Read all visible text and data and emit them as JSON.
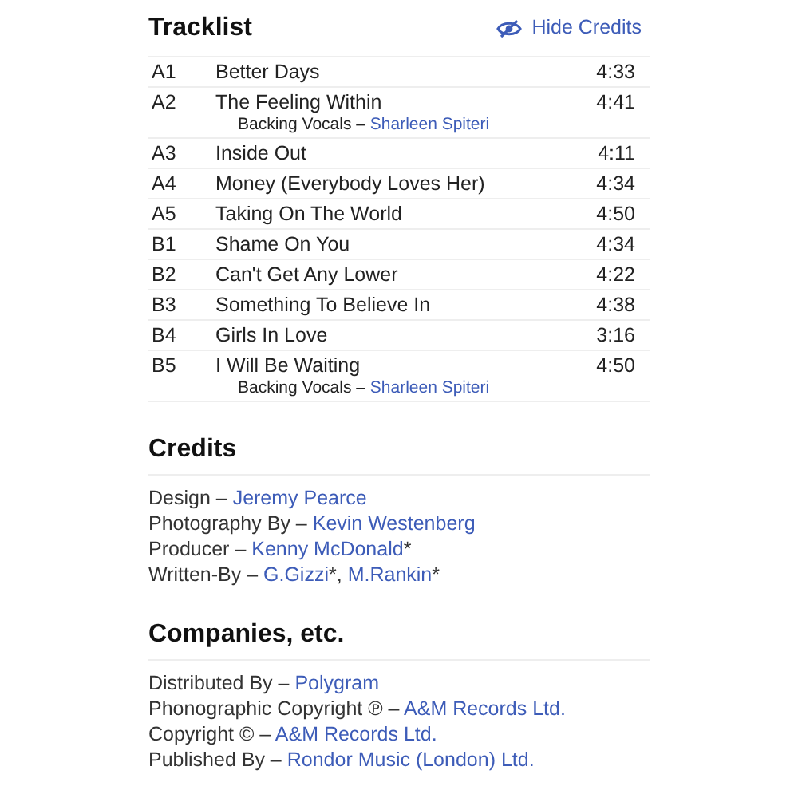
{
  "tracklist": {
    "title": "Tracklist",
    "toggle": "Hide Credits",
    "tracks": [
      {
        "position": "A1",
        "title": "Better Days",
        "duration": "4:33"
      },
      {
        "position": "A2",
        "title": "The Feeling Within",
        "duration": "4:41",
        "credit": {
          "role": "Backing Vocals –",
          "name": "Sharleen Spiteri"
        }
      },
      {
        "position": "A3",
        "title": "Inside Out",
        "duration": "4:11"
      },
      {
        "position": "A4",
        "title": "Money (Everybody Loves Her)",
        "duration": "4:34"
      },
      {
        "position": "A5",
        "title": "Taking On The World",
        "duration": "4:50"
      },
      {
        "position": "B1",
        "title": "Shame On You",
        "duration": "4:34"
      },
      {
        "position": "B2",
        "title": "Can't Get Any Lower",
        "duration": "4:22"
      },
      {
        "position": "B3",
        "title": "Something To Believe In",
        "duration": "4:38"
      },
      {
        "position": "B4",
        "title": "Girls In Love",
        "duration": "3:16"
      },
      {
        "position": "B5",
        "title": "I Will Be Waiting",
        "duration": "4:50",
        "credit": {
          "role": "Backing Vocals –",
          "name": "Sharleen Spiteri"
        }
      }
    ]
  },
  "credits": {
    "title": "Credits",
    "lines": [
      {
        "role": "Design –",
        "names": [
          {
            "name": "Jeremy Pearce"
          }
        ]
      },
      {
        "role": "Photography By –",
        "names": [
          {
            "name": "Kevin Westenberg"
          }
        ]
      },
      {
        "role": "Producer –",
        "names": [
          {
            "name": "Kenny McDonald",
            "suffix": "*"
          }
        ]
      },
      {
        "role": "Written-By –",
        "names": [
          {
            "name": "G.Gizzi",
            "suffix": "*,"
          },
          {
            "name": "M.Rankin",
            "suffix": "*"
          }
        ]
      }
    ]
  },
  "companies": {
    "title": "Companies, etc.",
    "lines": [
      {
        "role": "Distributed By –",
        "names": [
          {
            "name": "Polygram"
          }
        ]
      },
      {
        "role": "Phonographic Copyright ℗ –",
        "names": [
          {
            "name": "A&M Records Ltd."
          }
        ]
      },
      {
        "role": "Copyright © –",
        "names": [
          {
            "name": "A&M Records Ltd."
          }
        ]
      },
      {
        "role": "Published By –",
        "names": [
          {
            "name": "Rondor Music (London) Ltd."
          }
        ]
      }
    ]
  }
}
